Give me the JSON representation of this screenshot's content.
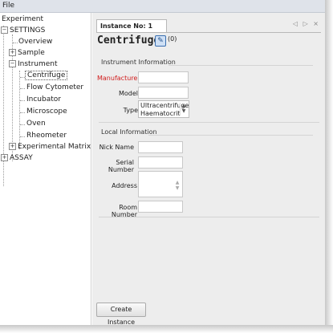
{
  "menu": {
    "file": "File"
  },
  "tree": {
    "experiment": "Experiment",
    "settings": "SETTINGS",
    "overview": "Overview",
    "sample": "Sample",
    "instrument": "Instrument",
    "centrifuge": "Centrifuge",
    "flow_cytometer": "Flow Cytometer",
    "incubator": "Incubator",
    "microscope": "Microscope",
    "oven": "Oven",
    "rheometer": "Rheometer",
    "experimental_matrix": "Experimental Matrix",
    "assay": "ASSAY",
    "expander_expanded": "−",
    "expander_collapsed": "+"
  },
  "tab": {
    "label": "Instance No: 1",
    "controls": "◁ ▷ ×"
  },
  "title": {
    "name": "Centrifuge",
    "count": "(0)"
  },
  "instrument_section": {
    "heading": "Instrument Information",
    "manufacturer_label": "Manufacturer",
    "model_label": "Model",
    "type_label": "Type",
    "type_options": [
      "Ultracentrifuges",
      "Haematocrit"
    ]
  },
  "local_section": {
    "heading": "Local Information",
    "nickname_label": "Nick Name",
    "serial_label": "Serial Number",
    "address_label": "Address",
    "room_label": "Room Number"
  },
  "actions": {
    "create_instance": "Create Instance"
  },
  "colors": {
    "required_label": "#d11a1a",
    "edit_icon": "#3a6fb0"
  }
}
